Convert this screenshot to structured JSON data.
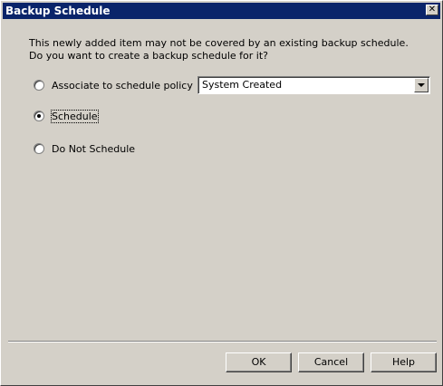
{
  "window": {
    "title": "Backup Schedule",
    "close_glyph": "✕"
  },
  "message": {
    "line1": "This newly added item may not be covered by an existing backup schedule.",
    "line2": "Do you want to create a backup schedule for it?"
  },
  "options": {
    "associate": {
      "label": "Associate to schedule policy",
      "checked": false
    },
    "schedule": {
      "label": "Schedule",
      "checked": true
    },
    "do_not_schedule": {
      "label": "Do Not Schedule",
      "checked": false
    }
  },
  "policy_select": {
    "value": "System Created"
  },
  "buttons": {
    "ok": "OK",
    "cancel": "Cancel",
    "help": "Help"
  },
  "colors": {
    "titlebar": "#0a246a",
    "face": "#d4d0c8"
  },
  "icons": {
    "close": "close-icon",
    "dropdown": "chevron-down-icon"
  }
}
